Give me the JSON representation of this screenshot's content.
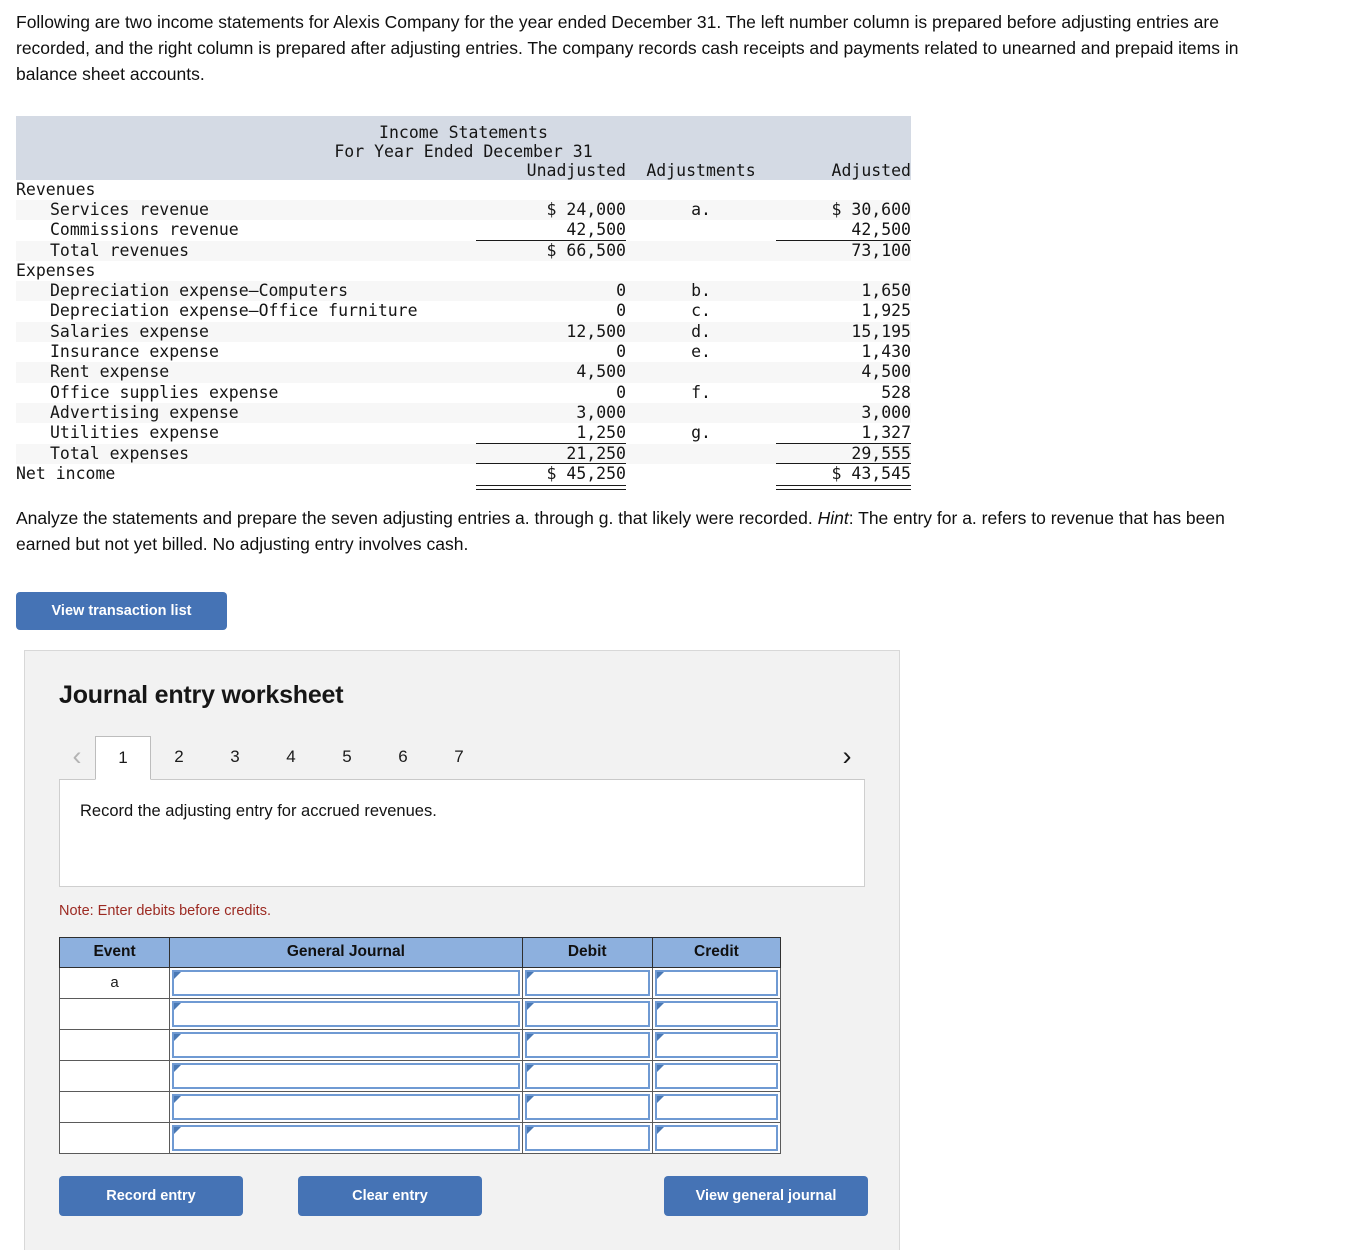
{
  "intro": {
    "paragraph": "Following are two income statements for Alexis Company for the year ended December 31. The left number column is prepared before adjusting entries are recorded, and the right column is prepared after adjusting entries. The company records cash receipts and payments related to unearned and prepaid items in balance sheet accounts."
  },
  "statement": {
    "title_line1": "Income Statements",
    "title_line2": "For Year Ended December 31",
    "columns": {
      "unadjusted": "Unadjusted",
      "adjustments": "Adjustments",
      "adjusted": "Adjusted"
    },
    "sections": {
      "revenues_header": "Revenues",
      "expenses_header": "Expenses"
    },
    "rows": [
      {
        "label": "Services revenue",
        "unadjusted": "$ 24,000",
        "ref": "a.",
        "adjusted": "$ 30,600"
      },
      {
        "label": "Commissions revenue",
        "unadjusted": "42,500",
        "ref": "",
        "adjusted": "42,500"
      },
      {
        "label": "Total revenues",
        "unadjusted": "$ 66,500",
        "ref": "",
        "adjusted": "73,100"
      },
      {
        "label": "Depreciation expense—Computers",
        "unadjusted": "0",
        "ref": "b.",
        "adjusted": "1,650"
      },
      {
        "label": "Depreciation expense—Office furniture",
        "unadjusted": "0",
        "ref": "c.",
        "adjusted": "1,925"
      },
      {
        "label": "Salaries expense",
        "unadjusted": "12,500",
        "ref": "d.",
        "adjusted": "15,195"
      },
      {
        "label": "Insurance expense",
        "unadjusted": "0",
        "ref": "e.",
        "adjusted": "1,430"
      },
      {
        "label": "Rent expense",
        "unadjusted": "4,500",
        "ref": "",
        "adjusted": "4,500"
      },
      {
        "label": "Office supplies expense",
        "unadjusted": "0",
        "ref": "f.",
        "adjusted": "528"
      },
      {
        "label": "Advertising expense",
        "unadjusted": "3,000",
        "ref": "",
        "adjusted": "3,000"
      },
      {
        "label": "Utilities expense",
        "unadjusted": "1,250",
        "ref": "g.",
        "adjusted": "1,327"
      },
      {
        "label": "Total expenses",
        "unadjusted": "21,250",
        "ref": "",
        "adjusted": "29,555"
      },
      {
        "label": "Net income",
        "unadjusted": "$ 45,250",
        "ref": "",
        "adjusted": "$ 43,545"
      }
    ]
  },
  "analyze": {
    "part1": "Analyze the statements and prepare the seven adjusting entries a. through g. that likely were recorded. ",
    "hint_label": "Hint",
    "part2": ": The entry for a. refers to revenue that has been earned but not yet billed. No adjusting entry involves cash."
  },
  "buttons": {
    "view_transaction_list": "View transaction list",
    "record_entry": "Record entry",
    "clear_entry": "Clear entry",
    "view_general_journal": "View general journal"
  },
  "worksheet": {
    "title": "Journal entry worksheet",
    "prev_arrow": "‹",
    "next_arrow": "›",
    "tabs": [
      "1",
      "2",
      "3",
      "4",
      "5",
      "6",
      "7"
    ],
    "active_tab": "1",
    "instruction": "Record the adjusting entry for accrued revenues.",
    "note": "Note: Enter debits before credits.",
    "table": {
      "headers": [
        "Event",
        "General Journal",
        "Debit",
        "Credit"
      ],
      "rows": [
        {
          "event": "a"
        },
        {
          "event": ""
        },
        {
          "event": ""
        },
        {
          "event": ""
        },
        {
          "event": ""
        },
        {
          "event": ""
        }
      ]
    }
  },
  "colors": {
    "accent_blue": "#4573b5",
    "table_header_band": "#d4dae4",
    "journal_header": "#8db0de",
    "note_red": "#9c2a22"
  }
}
